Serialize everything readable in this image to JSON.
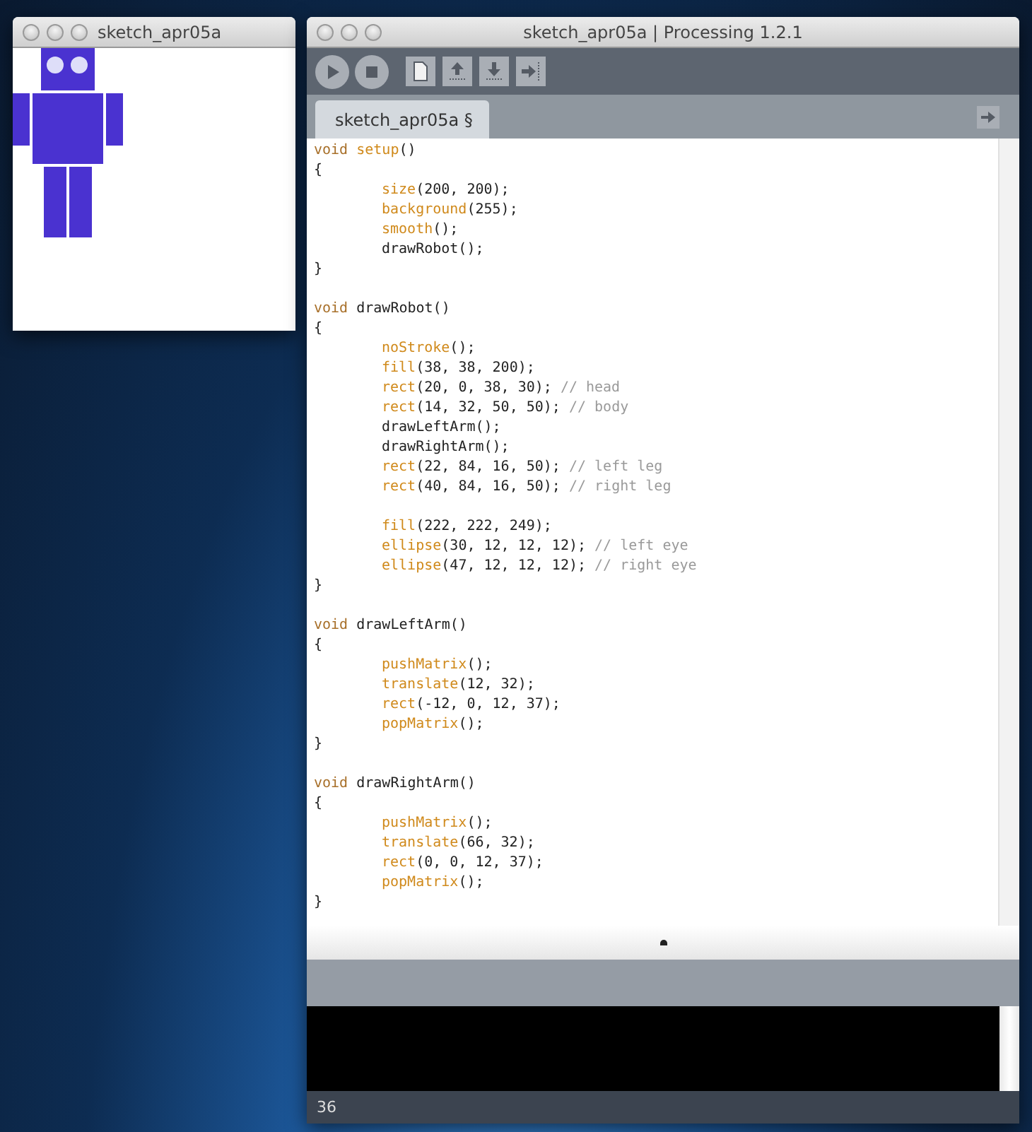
{
  "sketch_window": {
    "title": "sketch_apr05a"
  },
  "ide_window": {
    "title": "sketch_apr05a | Processing 1.2.1",
    "tabs": [
      {
        "label": "sketch_apr05a §",
        "selected": true
      }
    ],
    "code": [
      {
        "kind": "code",
        "tokens": [
          {
            "kind": "keyword",
            "text": "void"
          },
          {
            "kind": "function",
            "text": "setup"
          },
          {
            "kind": "plain",
            "text": "()"
          }
        ]
      },
      {
        "kind": "code",
        "tokens": [
          {
            "kind": "plain",
            "text": "{"
          }
        ],
        "children": [
          {
            "kind": "code",
            "tokens": [
              {
                "kind": "function",
                "text": "size"
              },
              {
                "kind": "plain",
                "text": "(200, 200);"
              }
            ]
          },
          {
            "kind": "code",
            "tokens": [
              {
                "kind": "function",
                "text": "background"
              },
              {
                "kind": "plain",
                "text": "(255);"
              }
            ]
          },
          {
            "kind": "code",
            "tokens": [
              {
                "kind": "function",
                "text": "smooth"
              },
              {
                "kind": "plain",
                "text": "();"
              }
            ]
          },
          {
            "kind": "code",
            "tokens": [
              {
                "kind": "plain",
                "text": "drawRobot();"
              }
            ]
          }
        ]
      },
      {
        "kind": "code",
        "tokens": [
          {
            "kind": "plain",
            "text": "}"
          }
        ]
      },
      {
        "kind": "blank"
      },
      {
        "kind": "code",
        "tokens": [
          {
            "kind": "keyword",
            "text": "void"
          },
          {
            "kind": "plain",
            "text": "drawRobot()"
          }
        ]
      },
      {
        "kind": "code",
        "tokens": [
          {
            "kind": "plain",
            "text": "{"
          }
        ],
        "children": [
          {
            "kind": "code",
            "tokens": [
              {
                "kind": "function",
                "text": "noStroke"
              },
              {
                "kind": "plain",
                "text": "();"
              }
            ]
          },
          {
            "kind": "code",
            "tokens": [
              {
                "kind": "function",
                "text": "fill"
              },
              {
                "kind": "plain",
                "text": "(38, 38, 200);"
              }
            ]
          },
          {
            "kind": "code",
            "tokens": [
              {
                "kind": "function",
                "text": "rect"
              },
              {
                "kind": "plain",
                "text": "(20, 0, 38, 30);"
              },
              {
                "kind": "comment",
                "text": "// head"
              }
            ]
          },
          {
            "kind": "code",
            "tokens": [
              {
                "kind": "function",
                "text": "rect"
              },
              {
                "kind": "plain",
                "text": "(14, 32, 50, 50);"
              },
              {
                "kind": "comment",
                "text": "// body"
              }
            ]
          },
          {
            "kind": "code",
            "tokens": [
              {
                "kind": "plain",
                "text": "drawLeftArm();"
              }
            ]
          },
          {
            "kind": "code",
            "tokens": [
              {
                "kind": "plain",
                "text": "drawRightArm();"
              }
            ]
          },
          {
            "kind": "code",
            "tokens": [
              {
                "kind": "function",
                "text": "rect"
              },
              {
                "kind": "plain",
                "text": "(22, 84, 16, 50);"
              },
              {
                "kind": "comment",
                "text": "// left leg"
              }
            ]
          },
          {
            "kind": "code",
            "tokens": [
              {
                "kind": "function",
                "text": "rect"
              },
              {
                "kind": "plain",
                "text": "(40, 84, 16, 50);"
              },
              {
                "kind": "comment",
                "text": "// right leg"
              }
            ]
          },
          {
            "kind": "blank"
          },
          {
            "kind": "code",
            "tokens": [
              {
                "kind": "function",
                "text": "fill"
              },
              {
                "kind": "plain",
                "text": "(222, 222, 249);"
              }
            ]
          },
          {
            "kind": "code",
            "tokens": [
              {
                "kind": "function",
                "text": "ellipse"
              },
              {
                "kind": "plain",
                "text": "(30, 12, 12, 12);"
              },
              {
                "kind": "comment",
                "text": "// left eye"
              }
            ]
          },
          {
            "kind": "code",
            "tokens": [
              {
                "kind": "function",
                "text": "ellipse"
              },
              {
                "kind": "plain",
                "text": "(47, 12, 12, 12);"
              },
              {
                "kind": "comment",
                "text": "// right eye"
              }
            ]
          }
        ]
      },
      {
        "kind": "code",
        "tokens": [
          {
            "kind": "plain",
            "text": "}"
          }
        ]
      },
      {
        "kind": "blank"
      },
      {
        "kind": "code",
        "tokens": [
          {
            "kind": "keyword",
            "text": "void"
          },
          {
            "kind": "plain",
            "text": "drawLeftArm()"
          }
        ]
      },
      {
        "kind": "code",
        "tokens": [
          {
            "kind": "plain",
            "text": "{"
          }
        ],
        "children": [
          {
            "kind": "code",
            "tokens": [
              {
                "kind": "function",
                "text": "pushMatrix"
              },
              {
                "kind": "plain",
                "text": "();"
              }
            ]
          },
          {
            "kind": "code",
            "tokens": [
              {
                "kind": "function",
                "text": "translate"
              },
              {
                "kind": "plain",
                "text": "(12, 32);"
              }
            ]
          },
          {
            "kind": "code",
            "tokens": [
              {
                "kind": "function",
                "text": "rect"
              },
              {
                "kind": "plain",
                "text": "(-12, 0, 12, 37);"
              }
            ]
          },
          {
            "kind": "code",
            "tokens": [
              {
                "kind": "function",
                "text": "popMatrix"
              },
              {
                "kind": "plain",
                "text": "();"
              }
            ]
          }
        ]
      },
      {
        "kind": "code",
        "tokens": [
          {
            "kind": "plain",
            "text": "}"
          }
        ]
      },
      {
        "kind": "blank"
      },
      {
        "kind": "code",
        "tokens": [
          {
            "kind": "keyword",
            "text": "void"
          },
          {
            "kind": "plain",
            "text": "drawRightArm()"
          }
        ]
      },
      {
        "kind": "code",
        "tokens": [
          {
            "kind": "plain",
            "text": "{"
          }
        ],
        "children": [
          {
            "kind": "code",
            "tokens": [
              {
                "kind": "function",
                "text": "pushMatrix"
              },
              {
                "kind": "plain",
                "text": "();"
              }
            ]
          },
          {
            "kind": "code",
            "tokens": [
              {
                "kind": "function",
                "text": "translate"
              },
              {
                "kind": "plain",
                "text": "(66, 32);"
              }
            ]
          },
          {
            "kind": "code",
            "tokens": [
              {
                "kind": "function",
                "text": "rect"
              },
              {
                "kind": "plain",
                "text": "(0, 0, 12, 37);"
              }
            ]
          },
          {
            "kind": "code",
            "tokens": [
              {
                "kind": "function",
                "text": "popMatrix"
              },
              {
                "kind": "plain",
                "text": "();"
              }
            ]
          }
        ]
      },
      {
        "kind": "code",
        "tokens": [
          {
            "kind": "plain",
            "text": "}"
          }
        ]
      }
    ],
    "status_bar": {
      "line_number": "36"
    }
  }
}
